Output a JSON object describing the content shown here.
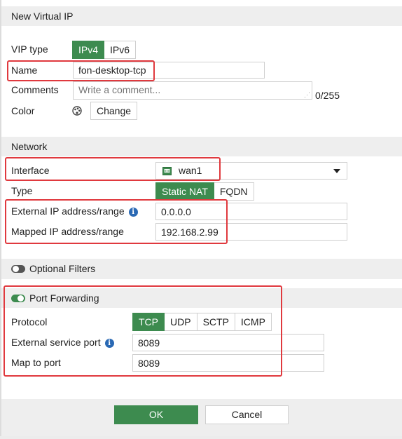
{
  "dialog": {
    "title": "New Virtual IP"
  },
  "form": {
    "vip_type_label": "VIP type",
    "vip_types": [
      "IPv4",
      "IPv6"
    ],
    "vip_type_selected": "IPv4",
    "name_label": "Name",
    "name_value": "fon-desktop-tcp",
    "comments_label": "Comments",
    "comments_placeholder": "Write a comment...",
    "comments_counter": "0/255",
    "color_label": "Color",
    "color_change_label": "Change"
  },
  "network": {
    "section_title": "Network",
    "interface_label": "Interface",
    "interface_value": "wan1",
    "type_label": "Type",
    "types": [
      "Static NAT",
      "FQDN"
    ],
    "type_selected": "Static NAT",
    "external_ip_label": "External IP address/range",
    "external_ip_value": "0.0.0.0",
    "mapped_ip_label": "Mapped IP address/range",
    "mapped_ip_value": "192.168.2.99"
  },
  "optional_filters": {
    "label": "Optional Filters",
    "enabled": false
  },
  "port_forwarding": {
    "label": "Port Forwarding",
    "enabled": true,
    "protocol_label": "Protocol",
    "protocols": [
      "TCP",
      "UDP",
      "SCTP",
      "ICMP"
    ],
    "protocol_selected": "TCP",
    "external_port_label": "External service port",
    "external_port_value": "8089",
    "map_port_label": "Map to port",
    "map_port_value": "8089"
  },
  "footer": {
    "ok_label": "OK",
    "cancel_label": "Cancel"
  },
  "colors": {
    "accent": "#3d8b4f",
    "highlight": "#e0393e",
    "info": "#2a69b4"
  }
}
